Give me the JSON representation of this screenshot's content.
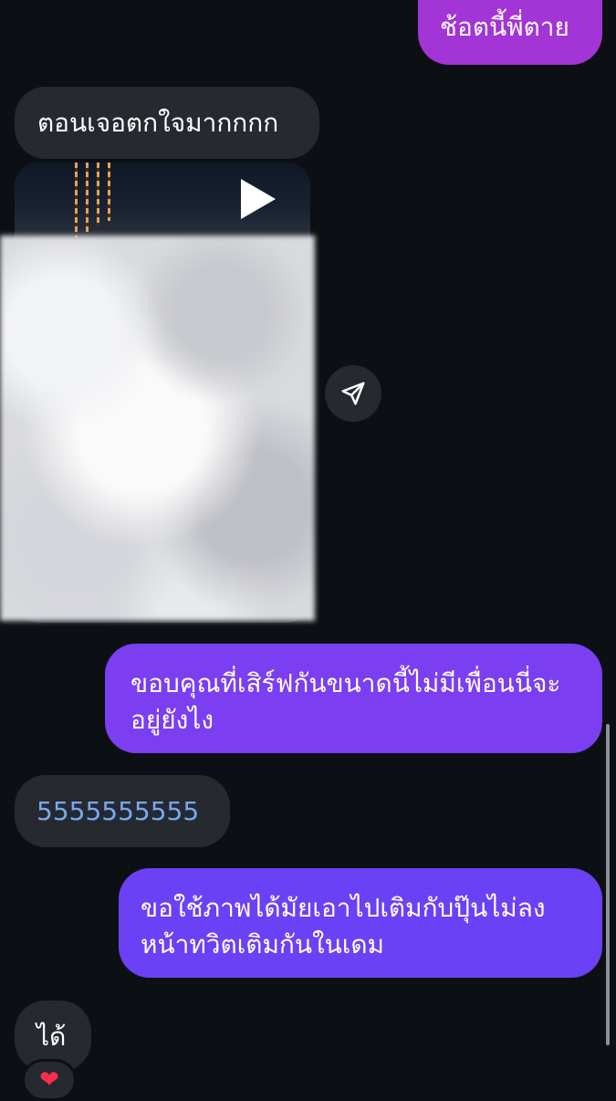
{
  "messages": {
    "top_sent": "ช้อตนี้พี่ตาย",
    "shock": "ตอนเจอตกใจมากกกก",
    "thanks_line1": "ขอบคุณที่เสิร์ฟกันขนาดนี้ไม่มีเพื่อนนี่จะ",
    "thanks_line2": "อยู่ยังไง",
    "laugh": "5555555555",
    "request_line1": "ขอใช้ภาพได้มัยเอาไปเติมกับปุ๊นไม่ลง",
    "request_line2": "หน้าทวิตเติมกันในเดม",
    "ok": "ได้",
    "reaction": "❤"
  },
  "icons": {
    "play": "play-icon",
    "share": "send-icon",
    "reaction": "heart-icon"
  },
  "colors": {
    "background": "#0c1014",
    "sent_top": "#a334d6",
    "sent_mid": "#7b3ef0",
    "sent_bottom": "#6b41f5",
    "received": "#262a30",
    "link_number": "#79a8f2"
  }
}
